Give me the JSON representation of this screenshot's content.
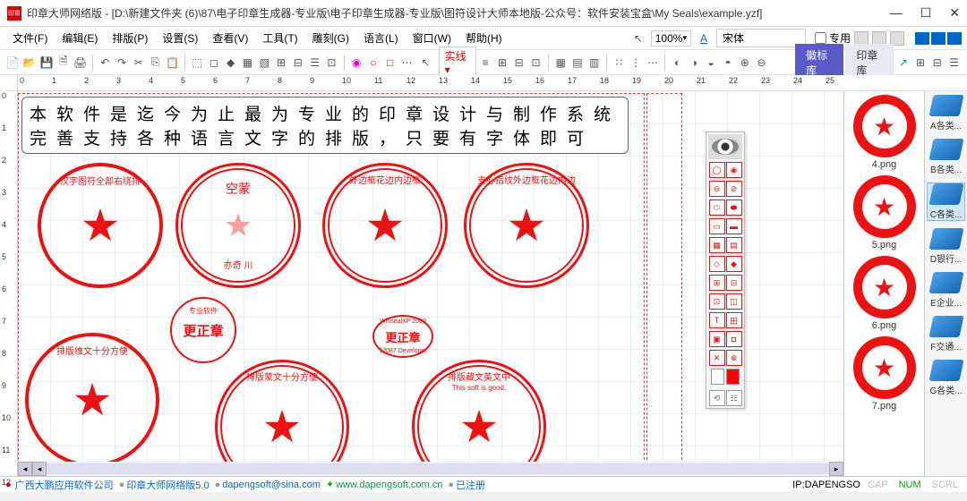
{
  "title": "印章大师网络版 - [D:\\新建文件夹 (6)\\87\\电子印章生成器-专业版\\电子印章生成器-专业版\\图符设计大师本地版-公众号：软件安装宝盒\\My Seals\\example.yzf]",
  "app_icon_text": "印章",
  "menu": {
    "file": "文件(F)",
    "edit": "编辑(E)",
    "layout": "排版(P)",
    "settings": "设置(S)",
    "view": "查看(V)",
    "tools": "工具(T)",
    "carve": "雕刻(G)",
    "language": "语言(L)",
    "window": "窗口(W)",
    "help": "帮助(H)"
  },
  "controls": {
    "zoom": "100%",
    "font": "宋体",
    "dedicated": "专用",
    "line_style": "实线"
  },
  "tabs": {
    "emblem": "徽标库",
    "seal": "印章库"
  },
  "canvas_text": {
    "line1": "本软件是迄今为止最为专业的印章设计与制作系统",
    "line2": "完善支持各种语言文字的排版，只要有字体即可"
  },
  "seals": {
    "s1": "汉字图符全部右绕排",
    "s2_top": "空蒙",
    "s2_bottom": "亦奇 川",
    "s3": "外边框花边内边框",
    "s4": "支心指纹外边框花边内边",
    "s5_top": "专业软件",
    "s5_center": "更正章",
    "s6_top": "WinsealXP 2009",
    "s6_center": "更正章",
    "s6_bottom": "12087 Developer",
    "s7": "排版维文十分方便",
    "s8": "排版蒙文十分方便",
    "s9_top": "This soft is good.",
    "s9": "排版藏文英文中"
  },
  "ruler_top": [
    "0",
    "1",
    "2",
    "3",
    "4",
    "5",
    "6",
    "7",
    "8",
    "9",
    "10",
    "11",
    "12",
    "13",
    "14",
    "15",
    "16",
    "17",
    "18",
    "19",
    "20",
    "21",
    "22",
    "23",
    "24",
    "25"
  ],
  "ruler_left": [
    "0",
    "1",
    "2",
    "3",
    "4",
    "5",
    "6",
    "7",
    "8",
    "9",
    "10",
    "11",
    "12"
  ],
  "gallery": [
    {
      "label": "4.png"
    },
    {
      "label": "5.png"
    },
    {
      "label": "6.png"
    },
    {
      "label": "7.png"
    }
  ],
  "sidebar": [
    {
      "label": "A各类..."
    },
    {
      "label": "B各类..."
    },
    {
      "label": "C各类..."
    },
    {
      "label": "D银行..."
    },
    {
      "label": "E企业..."
    },
    {
      "label": "F交通..."
    },
    {
      "label": "G各类..."
    }
  ],
  "status": {
    "company": "广西大鹏应用软件公司",
    "product": "印章大师网络版5.0",
    "email": "dapengsoft@sina.com",
    "website": "www.dapengsoft.com.cn",
    "registered": "已注册",
    "ip": "IP:DAPENGSO",
    "cap": "CAP",
    "num": "NUM",
    "scrl": "SCRL"
  }
}
